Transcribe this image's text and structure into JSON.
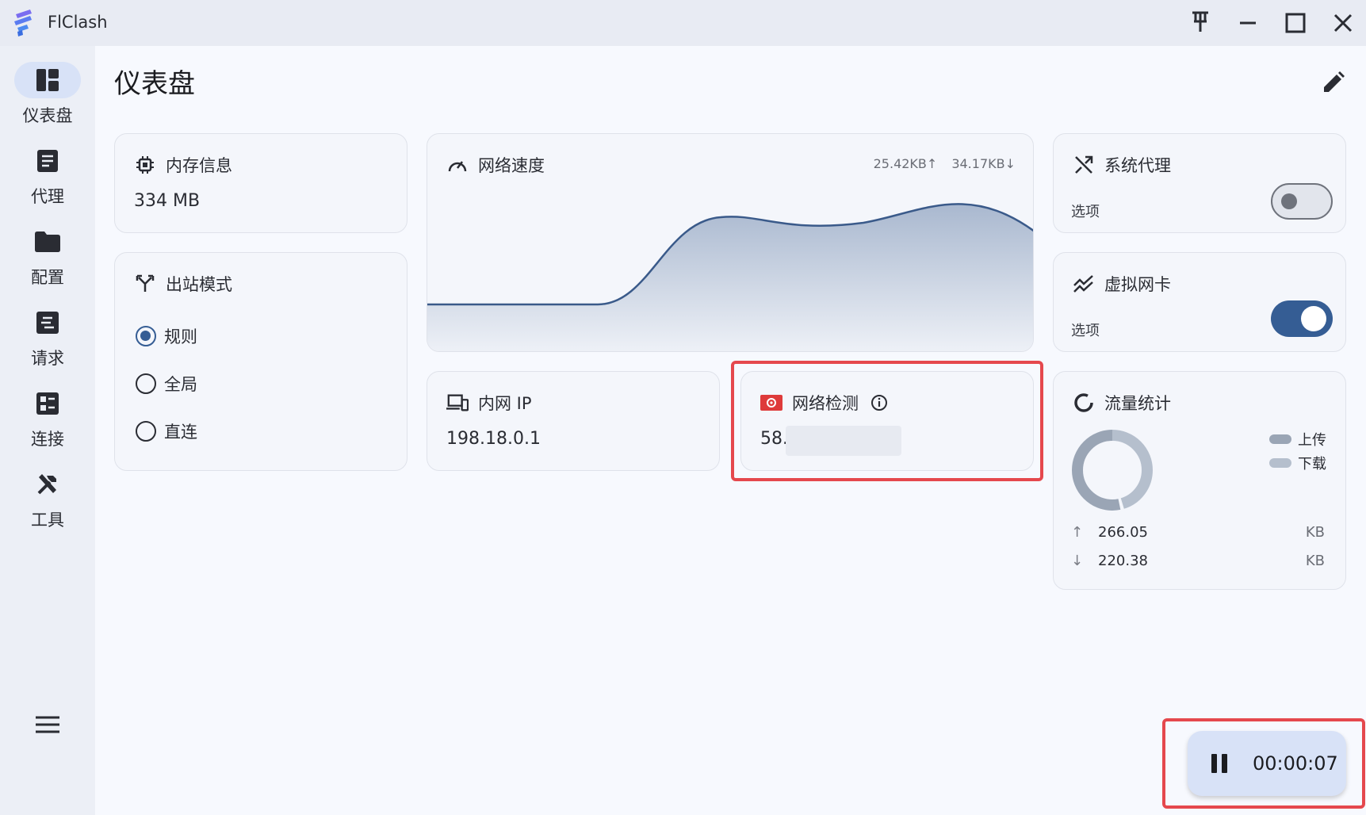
{
  "window": {
    "app_title": "FlClash"
  },
  "sidebar": {
    "items": [
      {
        "label": "仪表盘",
        "icon": "dashboard-icon",
        "active": true
      },
      {
        "label": "代理",
        "icon": "proxy-icon",
        "active": false
      },
      {
        "label": "配置",
        "icon": "folder-icon",
        "active": false
      },
      {
        "label": "请求",
        "icon": "requests-icon",
        "active": false
      },
      {
        "label": "连接",
        "icon": "connections-icon",
        "active": false
      },
      {
        "label": "工具",
        "icon": "tools-icon",
        "active": false
      }
    ]
  },
  "page": {
    "title": "仪表盘"
  },
  "memory": {
    "title": "内存信息",
    "value": "334  MB"
  },
  "outbound": {
    "title": "出站模式",
    "options": [
      {
        "label": "规则",
        "selected": true
      },
      {
        "label": "全局",
        "selected": false
      },
      {
        "label": "直连",
        "selected": false
      }
    ]
  },
  "network_speed": {
    "title": "网络速度",
    "upload": "25.42KB↑",
    "download": "34.17KB↓"
  },
  "system_proxy": {
    "title": "系统代理",
    "option_label": "选项",
    "enabled": false
  },
  "tun": {
    "title": "虚拟网卡",
    "option_label": "选项",
    "enabled": true
  },
  "intranet_ip": {
    "title": "内网 IP",
    "value": "198.18.0.1"
  },
  "network_check": {
    "title": "网络检测",
    "value": "58."
  },
  "traffic": {
    "title": "流量统计",
    "legend": [
      "上传",
      "下载"
    ],
    "upload_value": "266.05",
    "upload_unit": "KB",
    "download_value": "220.38",
    "download_unit": "KB",
    "colors": {
      "upload": "#9aa5b5",
      "download": "#b5bfcd"
    }
  },
  "timer": {
    "time": "00:00:07"
  },
  "colors": {
    "accent": "#355d94",
    "highlight": "#e5484d"
  }
}
